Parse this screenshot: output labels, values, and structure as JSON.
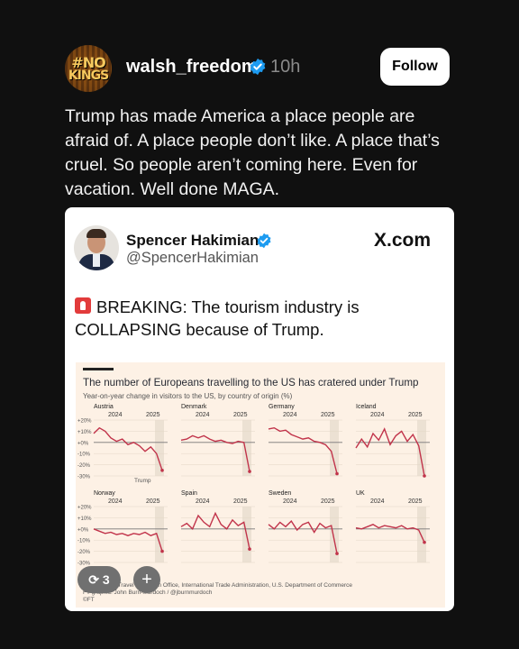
{
  "post": {
    "avatar_text_1": "#NO",
    "avatar_text_2": "KINGS",
    "username": "walsh_freedom",
    "time": "10h",
    "follow_label": "Follow",
    "text": "Trump has made America a place people are afraid of. A place people don’t like. A place that’s cruel. So people aren’t coming here. Even for vacation. Well done MAGA."
  },
  "quote": {
    "name": "Spencer Hakimian",
    "handle": "@SpencerHakimian",
    "site": "X.com",
    "text": "BREAKING: The tourism industry is COLLAPSING because of Trump."
  },
  "overlay": {
    "repost_count": "3",
    "plus": "+"
  },
  "colors": {
    "background": "#101010",
    "verified": "#1d9bf0",
    "chart_bg": "#fdf1e5",
    "line": "#c1334a"
  },
  "chart_data": {
    "type": "line",
    "title": "The number of Europeans travelling to the US has cratered under Trump",
    "subtitle": "Year-on-year change in visitors to the US, by country of origin (%)",
    "x_tick_labels": [
      "2024",
      "2025"
    ],
    "y_tick_labels": [
      "+20%",
      "+10%",
      "+0%",
      "-10%",
      "-20%",
      "-30%"
    ],
    "ylim": [
      -30,
      20
    ],
    "annotation": "Trump",
    "source_line_1": "Source: Nat'l Travel & Tourism Office, International Trade Administration, U.S. Department of Commerce",
    "source_line_2": "FT graphic: John Burn-Murdoch / @jburnmurdoch",
    "source_line_3": "©FT",
    "panels": [
      {
        "name": "Austria",
        "values": [
          8,
          13,
          10,
          4,
          1,
          3,
          -2,
          0,
          -3,
          -8,
          -4,
          -10,
          -25
        ]
      },
      {
        "name": "Denmark",
        "values": [
          2,
          3,
          6,
          4,
          6,
          3,
          1,
          2,
          0,
          -1,
          1,
          0,
          -26
        ]
      },
      {
        "name": "Germany",
        "values": [
          12,
          13,
          10,
          11,
          7,
          5,
          3,
          4,
          1,
          0,
          -2,
          -8,
          -28
        ]
      },
      {
        "name": "Iceland",
        "values": [
          -5,
          3,
          -4,
          8,
          2,
          12,
          -2,
          6,
          10,
          1,
          7,
          -3,
          -30
        ]
      },
      {
        "name": "Norway",
        "values": [
          0,
          -2,
          -4,
          -3,
          -5,
          -4,
          -6,
          -4,
          -5,
          -3,
          -6,
          -4,
          -20
        ]
      },
      {
        "name": "Spain",
        "values": [
          2,
          5,
          0,
          12,
          6,
          2,
          14,
          4,
          0,
          8,
          3,
          6,
          -18
        ]
      },
      {
        "name": "Sweden",
        "values": [
          4,
          0,
          6,
          2,
          7,
          -1,
          4,
          6,
          -3,
          5,
          1,
          3,
          -22
        ]
      },
      {
        "name": "UK",
        "values": [
          1,
          0,
          2,
          4,
          1,
          3,
          2,
          1,
          3,
          0,
          1,
          -1,
          -12
        ]
      }
    ]
  }
}
